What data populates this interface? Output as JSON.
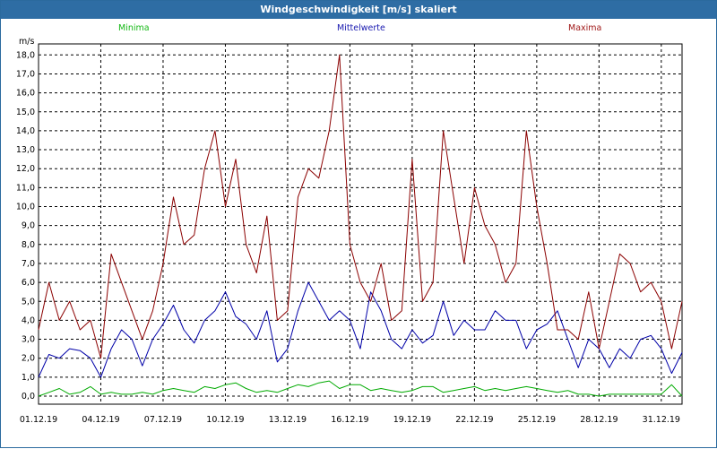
{
  "window": {
    "title": "Windgeschwindigkeit [m/s] skaliert"
  },
  "legend": {
    "minima": "Minima",
    "mean": "Mittelwerte",
    "maxima": "Maxima"
  },
  "colors": {
    "title_bar": "#2e6da4",
    "minima": "#00aa00",
    "mean": "#0000a8",
    "maxima": "#8b0000",
    "grid": "#000000"
  },
  "chart_data": {
    "type": "line",
    "ylabel": "m/s",
    "ylim": [
      0,
      19
    ],
    "y_ticks": [
      "0,0",
      "1,0",
      "2,0",
      "3,0",
      "4,0",
      "5,0",
      "6,0",
      "7,0",
      "8,0",
      "9,0",
      "10,0",
      "11,0",
      "12,0",
      "13,0",
      "14,0",
      "15,0",
      "16,0",
      "17,0",
      "18,0"
    ],
    "x_ticks": [
      "01.12.19",
      "04.12.19",
      "07.12.19",
      "10.12.19",
      "13.12.19",
      "16.12.19",
      "19.12.19",
      "22.12.19",
      "25.12.19",
      "28.12.19",
      "31.12.19"
    ],
    "x_start": "01.12.19",
    "x_end": "01.01.20",
    "grid": true,
    "x": [
      "01.12.19",
      "01.12.19 12:00",
      "02.12.19",
      "02.12.19 12:00",
      "03.12.19",
      "03.12.19 12:00",
      "04.12.19",
      "04.12.19 12:00",
      "05.12.19",
      "05.12.19 12:00",
      "06.12.19",
      "06.12.19 12:00",
      "07.12.19",
      "07.12.19 12:00",
      "08.12.19",
      "08.12.19 12:00",
      "09.12.19",
      "09.12.19 12:00",
      "10.12.19",
      "10.12.19 12:00",
      "11.12.19",
      "11.12.19 12:00",
      "12.12.19",
      "12.12.19 12:00",
      "13.12.19",
      "13.12.19 12:00",
      "14.12.19",
      "14.12.19 12:00",
      "15.12.19",
      "15.12.19 12:00",
      "16.12.19",
      "16.12.19 12:00",
      "17.12.19",
      "17.12.19 12:00",
      "18.12.19",
      "18.12.19 12:00",
      "19.12.19",
      "19.12.19 12:00",
      "20.12.19",
      "20.12.19 12:00",
      "21.12.19",
      "21.12.19 12:00",
      "22.12.19",
      "22.12.19 12:00",
      "23.12.19",
      "23.12.19 12:00",
      "24.12.19",
      "24.12.19 12:00",
      "25.12.19",
      "25.12.19 12:00",
      "26.12.19",
      "26.12.19 12:00",
      "27.12.19",
      "27.12.19 12:00",
      "28.12.19",
      "28.12.19 12:00",
      "29.12.19",
      "29.12.19 12:00",
      "30.12.19",
      "30.12.19 12:00",
      "31.12.19",
      "31.12.19 12:00",
      "01.01.20"
    ],
    "series": [
      {
        "name": "Minima",
        "color": "#00aa00",
        "values": [
          0.0,
          0.2,
          0.4,
          0.1,
          0.2,
          0.5,
          0.1,
          0.2,
          0.1,
          0.1,
          0.2,
          0.1,
          0.3,
          0.4,
          0.3,
          0.2,
          0.5,
          0.4,
          0.6,
          0.7,
          0.4,
          0.2,
          0.3,
          0.2,
          0.4,
          0.6,
          0.5,
          0.7,
          0.8,
          0.4,
          0.6,
          0.6,
          0.3,
          0.4,
          0.3,
          0.2,
          0.3,
          0.5,
          0.5,
          0.2,
          0.3,
          0.4,
          0.5,
          0.3,
          0.4,
          0.3,
          0.4,
          0.5,
          0.4,
          0.3,
          0.2,
          0.3,
          0.1,
          0.1,
          0.0,
          0.1,
          0.1,
          0.1,
          0.1,
          0.1,
          0.1,
          0.6,
          0.0
        ]
      },
      {
        "name": "Mittelwerte",
        "color": "#0000a8",
        "values": [
          1.0,
          2.2,
          2.0,
          2.5,
          2.4,
          2.0,
          1.0,
          2.5,
          3.5,
          3.0,
          1.6,
          3.0,
          3.8,
          4.8,
          3.5,
          2.8,
          4.0,
          4.5,
          5.5,
          4.2,
          3.8,
          3.0,
          4.5,
          1.8,
          2.5,
          4.5,
          6.0,
          5.0,
          4.0,
          4.5,
          4.0,
          2.5,
          5.5,
          4.5,
          3.0,
          2.5,
          3.5,
          2.8,
          3.2,
          5.0,
          3.2,
          4.0,
          3.5,
          3.5,
          4.5,
          4.0,
          4.0,
          2.5,
          3.5,
          3.8,
          4.5,
          3.0,
          1.5,
          3.0,
          2.5,
          1.5,
          2.5,
          2.0,
          3.0,
          3.2,
          2.5,
          1.2,
          2.3
        ]
      },
      {
        "name": "Maxima",
        "color": "#8b0000",
        "values": [
          3.5,
          6.0,
          4.0,
          5.0,
          3.5,
          4.0,
          2.0,
          7.5,
          6.0,
          4.5,
          3.0,
          4.5,
          7.0,
          10.5,
          8.0,
          8.5,
          12.0,
          14.0,
          10.0,
          12.5,
          8.0,
          6.5,
          9.5,
          4.0,
          4.5,
          10.5,
          12.0,
          11.5,
          14.0,
          18.0,
          8.0,
          6.0,
          5.0,
          7.0,
          4.0,
          4.5,
          12.5,
          5.0,
          6.0,
          14.0,
          10.5,
          7.0,
          11.0,
          9.0,
          8.0,
          6.0,
          7.0,
          14.0,
          10.0,
          7.0,
          3.5,
          3.5,
          3.0,
          5.5,
          2.5,
          5.0,
          7.5,
          7.0,
          5.5,
          6.0,
          5.0,
          2.5,
          5.0
        ]
      }
    ]
  }
}
